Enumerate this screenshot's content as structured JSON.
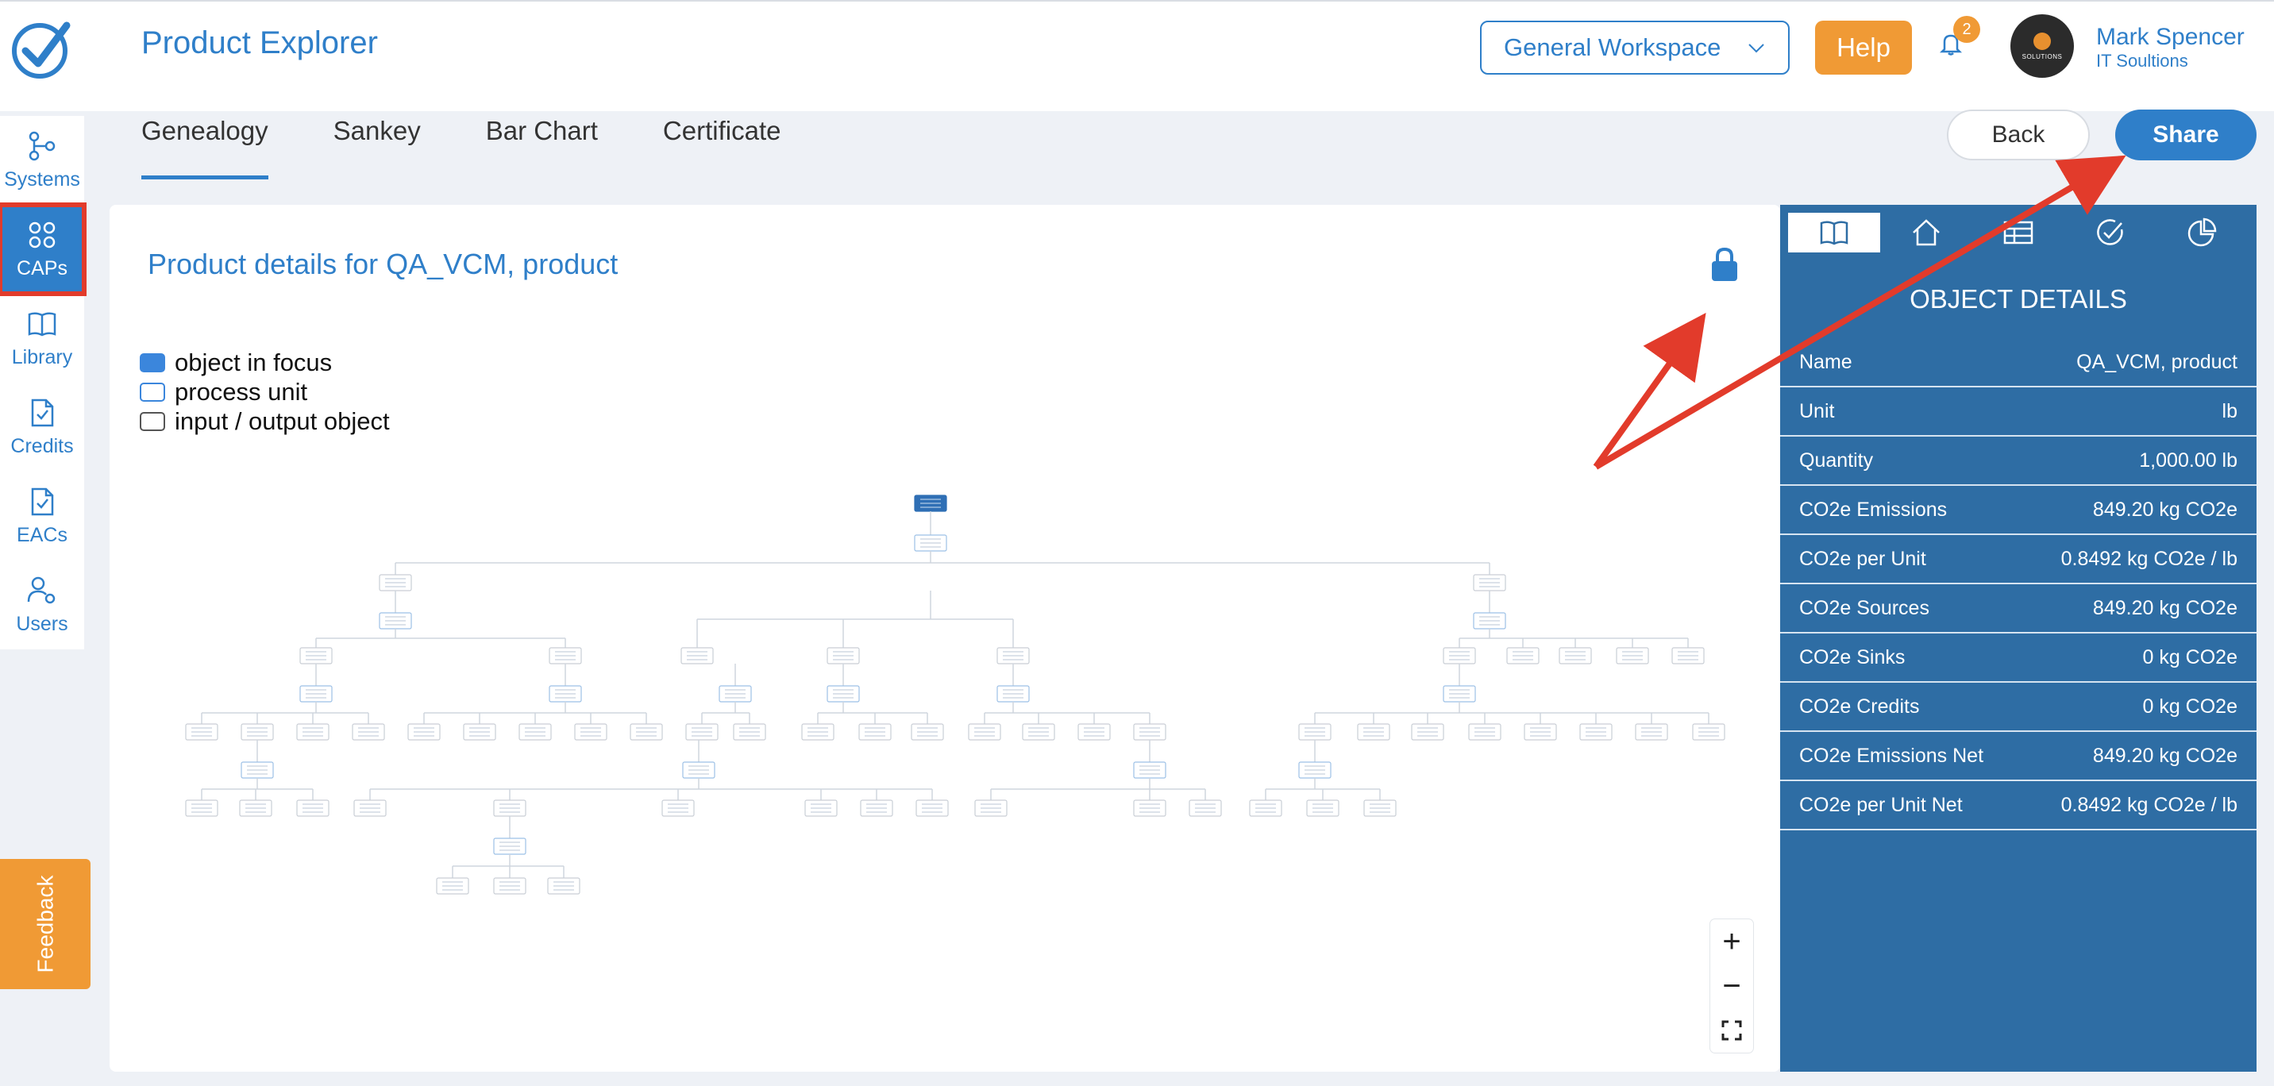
{
  "app": {
    "title": "Product Explorer",
    "workspace_selected": "General Workspace",
    "help_label": "Help",
    "notification_count": "2",
    "user_name": "Mark Spencer",
    "user_org": "IT Soultions",
    "avatar_icon": "user-avatar"
  },
  "tabs": [
    {
      "label": "Genealogy",
      "active": true
    },
    {
      "label": "Sankey",
      "active": false
    },
    {
      "label": "Bar Chart",
      "active": false
    },
    {
      "label": "Certificate",
      "active": false
    }
  ],
  "actions": {
    "back_label": "Back",
    "share_label": "Share"
  },
  "sidebar": {
    "items": [
      {
        "label": "Systems",
        "icon": "systems-icon"
      },
      {
        "label": "CAPs",
        "icon": "grid-icon",
        "active": true
      },
      {
        "label": "Library",
        "icon": "book-icon"
      },
      {
        "label": "Credits",
        "icon": "document-check-icon"
      },
      {
        "label": "EACs",
        "icon": "document-check-icon"
      },
      {
        "label": "Users",
        "icon": "users-settings-icon"
      }
    ],
    "feedback_label": "Feedback"
  },
  "main": {
    "product_title": "Product details for QA_VCM, product",
    "lock_icon": "lock-icon",
    "legend": [
      "object in focus",
      "process unit",
      "input / output object"
    ],
    "zoom_in": "+",
    "zoom_out": "−",
    "fit_icon": "fullscreen-icon"
  },
  "details": {
    "title": "OBJECT DETAILS",
    "tab_icons": [
      "book-icon",
      "home-icon",
      "table-icon",
      "check-circle-icon",
      "pie-chart-icon"
    ],
    "rows": [
      {
        "label": "Name",
        "value": "QA_VCM, product"
      },
      {
        "label": "Unit",
        "value": "lb"
      },
      {
        "label": "Quantity",
        "value": "1,000.00 lb"
      },
      {
        "label": "CO2e Emissions",
        "value": "849.20 kg CO2e"
      },
      {
        "label": "CO2e per Unit",
        "value": "0.8492 kg CO2e / lb"
      },
      {
        "label": "CO2e Sources",
        "value": "849.20 kg CO2e"
      },
      {
        "label": "CO2e Sinks",
        "value": "0 kg CO2e"
      },
      {
        "label": "CO2e Credits",
        "value": "0 kg CO2e"
      },
      {
        "label": "CO2e Emissions Net",
        "value": "849.20 kg CO2e"
      },
      {
        "label": "CO2e per Unit Net",
        "value": "0.8492 kg CO2e / lb"
      }
    ]
  },
  "colors": {
    "brand_blue": "#2f7fc9",
    "panel_blue": "#2e6da4",
    "accent_orange": "#f09a35",
    "annotation_red": "#e23b2b"
  }
}
